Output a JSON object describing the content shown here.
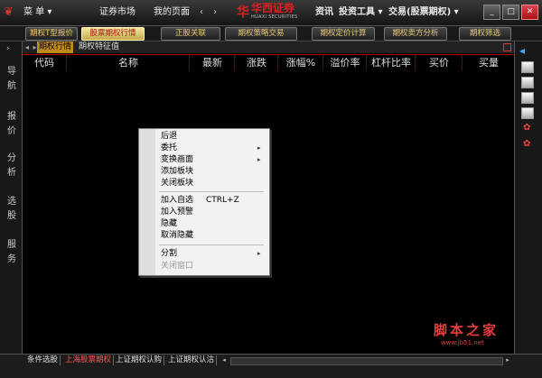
{
  "titlebar": {
    "menu_label": "菜 单 ▾",
    "market": "证券市场",
    "mypage": "我的页面",
    "nav_arrows": "‹ ›",
    "brand_name": "华西证券",
    "brand_sub": "HUAXI SECURITIES",
    "news": "资讯",
    "tools": "投资工具 ▾",
    "trade": "交易(股票期权) ▾",
    "win_min": "_",
    "win_max": "□",
    "win_close": "✕"
  },
  "toolbar": {
    "buttons": [
      "期权T型报价",
      "股票期权行情",
      "正股关联",
      "期权策略交易",
      "期权定价计算",
      "期权卖方分析",
      "期权筛选"
    ]
  },
  "left_rail": {
    "arrow": "›",
    "chars": [
      "导",
      "航",
      "报",
      "价",
      "分",
      "析",
      "选",
      "股",
      "服",
      "务"
    ]
  },
  "right_rail": {
    "arrow": "◂",
    "icons": [
      "chart-icon",
      "calendar-icon",
      "grid-icon",
      "display-icon",
      "lock-icon",
      "settings-icon"
    ]
  },
  "tabs": {
    "nav": "◂ ▸",
    "active": "期权行情",
    "second": "期权特征值"
  },
  "table": {
    "columns": [
      "代码",
      "名称",
      "最新",
      "涨跌",
      "涨幅%",
      "溢价率",
      "杠杆比率",
      "买价",
      "买量"
    ]
  },
  "context_menu": {
    "items": [
      {
        "label": "后退",
        "disabled": false,
        "arrow": false
      },
      {
        "label": "委托",
        "disabled": false,
        "arrow": true
      },
      {
        "label": "变换画面",
        "disabled": false,
        "arrow": true
      },
      {
        "label": "添加板块",
        "disabled": false,
        "arrow": false
      },
      {
        "label": "关闭板块",
        "disabled": false,
        "arrow": false
      },
      {
        "label": "加入自选",
        "disabled": false,
        "arrow": false
      },
      {
        "label": "加入预警",
        "disabled": false,
        "arrow": false
      },
      {
        "label": "隐藏",
        "disabled": false,
        "arrow": false
      },
      {
        "label": "取消隐藏",
        "disabled": false,
        "arrow": false
      },
      {
        "label": "分割",
        "disabled": false,
        "arrow": true
      },
      {
        "label": "关闭窗口",
        "disabled": true,
        "arrow": false
      }
    ],
    "shortcut": "CTRL+Z",
    "arrow_glyph": "▸"
  },
  "bottom_tabs": [
    "条件选股",
    "上海股票期权",
    "上证期权认购",
    "上证期权认沽"
  ],
  "bottom_scroll": {
    "left": "◂",
    "right": "▸"
  },
  "watermark": {
    "main": "脚本之家",
    "sub": "www.jb51.net"
  },
  "colors": {
    "accent": "#c08a1a",
    "header_line": "#b00000",
    "brand_red": "#dd2222"
  }
}
